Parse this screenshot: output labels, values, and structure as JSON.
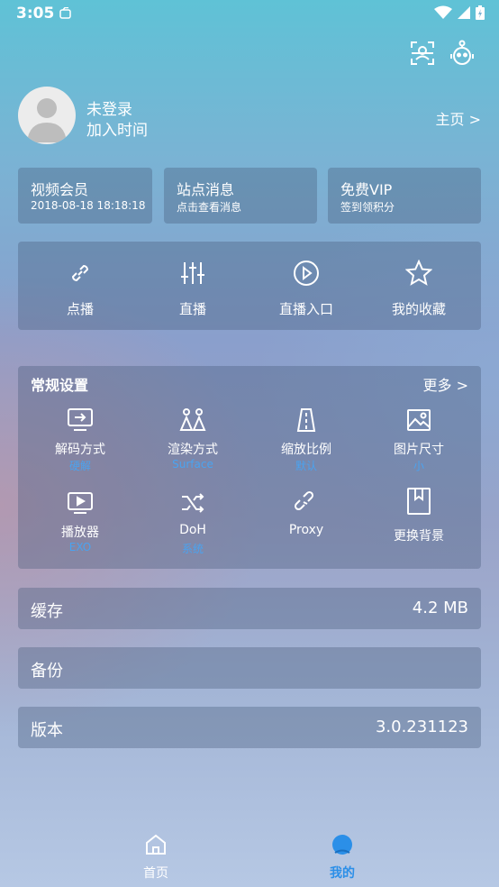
{
  "status_bar": {
    "time": "3:05"
  },
  "top_actions": {
    "scan_icon": "scan-icon",
    "robot_icon": "robot-icon"
  },
  "profile": {
    "username": "未登录",
    "join_time": "加入时间",
    "homepage_link": "主页 >"
  },
  "cards": [
    {
      "title": "视频会员",
      "subtitle": "2018-08-18 18:18:18"
    },
    {
      "title": "站点消息",
      "subtitle": "点击查看消息"
    },
    {
      "title": "免费VIP",
      "subtitle": "签到领积分"
    }
  ],
  "quick_actions": [
    {
      "label": "点播",
      "icon": "link-icon"
    },
    {
      "label": "直播",
      "icon": "sliders-icon"
    },
    {
      "label": "直播入口",
      "icon": "play-circle-icon"
    },
    {
      "label": "我的收藏",
      "icon": "star-icon"
    }
  ],
  "settings": {
    "title": "常规设置",
    "more": "更多 >",
    "items": [
      {
        "label": "解码方式",
        "value": "硬解",
        "icon": "decoder-icon"
      },
      {
        "label": "渲染方式",
        "value": "Surface",
        "icon": "render-icon"
      },
      {
        "label": "缩放比例",
        "value": "默认",
        "icon": "scale-icon"
      },
      {
        "label": "图片尺寸",
        "value": "小",
        "icon": "image-icon"
      },
      {
        "label": "播放器",
        "value": "EXO",
        "icon": "player-icon"
      },
      {
        "label": "DoH",
        "value": "系统",
        "icon": "shuffle-icon"
      },
      {
        "label": "Proxy",
        "value": "",
        "icon": "broken-link-icon"
      },
      {
        "label": "更换背景",
        "value": "",
        "icon": "bookmark-icon"
      }
    ]
  },
  "rows": {
    "cache": {
      "label": "缓存",
      "value": "4.2 MB"
    },
    "backup": {
      "label": "备份"
    },
    "version": {
      "label": "版本",
      "value": "3.0.231123"
    }
  },
  "bottom_nav": {
    "home": {
      "label": "首页",
      "icon": "home-icon"
    },
    "mine": {
      "label": "我的",
      "icon": "user-icon"
    }
  },
  "colors": {
    "accent": "#4aa3f0",
    "card_bg": "rgba(70,90,120,0.35)"
  }
}
